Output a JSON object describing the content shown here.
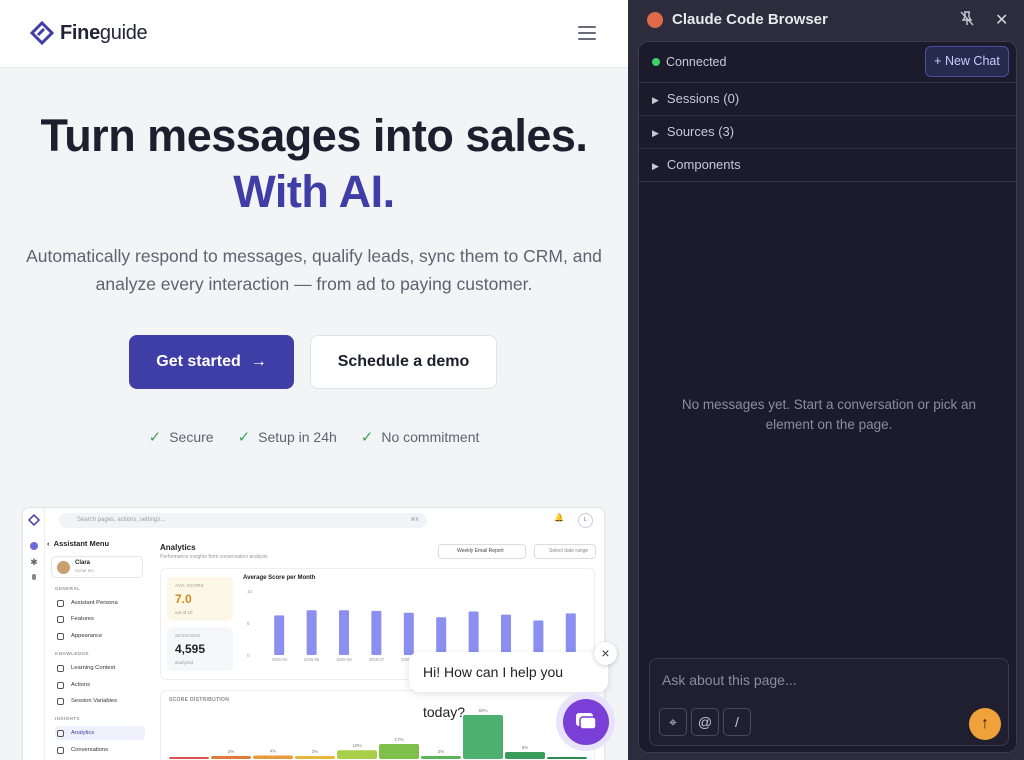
{
  "site": {
    "brand": {
      "bold": "Fine",
      "light": "guide"
    },
    "hero_line1": "Turn messages into sales.",
    "hero_line2": "With AI.",
    "subtitle": "Automatically respond to messages, qualify leads, sync them to CRM, and analyze every interaction — from ad to paying customer.",
    "cta_primary": "Get started",
    "cta_secondary": "Schedule a demo",
    "features": [
      "Secure",
      "Setup in 24h",
      "No commitment"
    ],
    "colors": {
      "accent": "#3f3da6",
      "check": "#3aa45f"
    }
  },
  "dashboard": {
    "search_placeholder": "Search pages, actions, settings...",
    "search_kbd": "⌘K",
    "avatar_initial": "L",
    "sidebar_title": "Assistant Menu",
    "user": {
      "name": "Clara",
      "company": "Acme Inc"
    },
    "sections": {
      "general": "GENERAL",
      "knowledge": "KNOWLEDGE",
      "insights": "INSIGHTS"
    },
    "items": {
      "persona": "Assistant Persona",
      "features": "Features",
      "appearance": "Appearance",
      "learning": "Learning Context",
      "actions": "Actions",
      "variables": "Session Variables",
      "analytics": "Analytics",
      "conversations": "Conversations"
    },
    "page_title": "Analytics",
    "page_subtitle": "Performance insights from conversation analysis",
    "weekly_label": "Weekly Email Report",
    "date_label": "Select date range",
    "kpi_score": {
      "label": "AVG SCORE",
      "value": "7.0",
      "note": "out of 10"
    },
    "kpi_sessions": {
      "label": "SESSIONS",
      "value": "4,595",
      "note": "analyzed"
    },
    "dist_title": "SCORE DISTRIBUTION",
    "chart_data": [
      {
        "type": "bar",
        "title": "Average Score per Month",
        "categories": [
          "2025-04",
          "2025-05",
          "2025-06",
          "2025-07",
          "2025-08",
          "",
          "",
          "",
          "",
          ""
        ],
        "values": [
          6.2,
          7.0,
          7.0,
          6.9,
          6.6,
          5.9,
          6.8,
          6.3,
          5.4,
          6.5
        ],
        "ylim": [
          0,
          10
        ],
        "yticks": [
          "10",
          "5",
          "0"
        ],
        "color": "#8a8ff0"
      },
      {
        "type": "bar",
        "title": "SCORE DISTRIBUTION",
        "values": [
          null,
          2,
          4,
          3,
          10,
          17,
          2,
          50,
          8,
          null
        ],
        "labels": [
          "",
          "2%",
          "4%",
          "3%",
          "10%",
          "17%",
          "2%",
          "50%",
          "8%",
          ""
        ],
        "colors": [
          "#d9534f",
          "#e07a3a",
          "#e89a3a",
          "#e8b83a",
          "#a8cf4a",
          "#7fc04a",
          "#5bb45a",
          "#4db06f",
          "#3a9c5a",
          "#2e8a4f"
        ]
      }
    ]
  },
  "widget": {
    "greeting": "Hi! How can I help you today?",
    "close": "×"
  },
  "panel": {
    "title": "Claude Code Browser",
    "status": "Connected",
    "new_chat": "+ New Chat",
    "rows": [
      "Sessions (0)",
      "Sources (3)",
      "Components"
    ],
    "empty": "No messages yet. Start a conversation or pick an element on the page.",
    "input_placeholder": "Ask about this page...",
    "tools": {
      "pick": "⌖",
      "mention": "@",
      "command": "/"
    },
    "send": "↑",
    "colors": {
      "connected": "#3fcf6a",
      "send": "#f0a23a"
    }
  }
}
